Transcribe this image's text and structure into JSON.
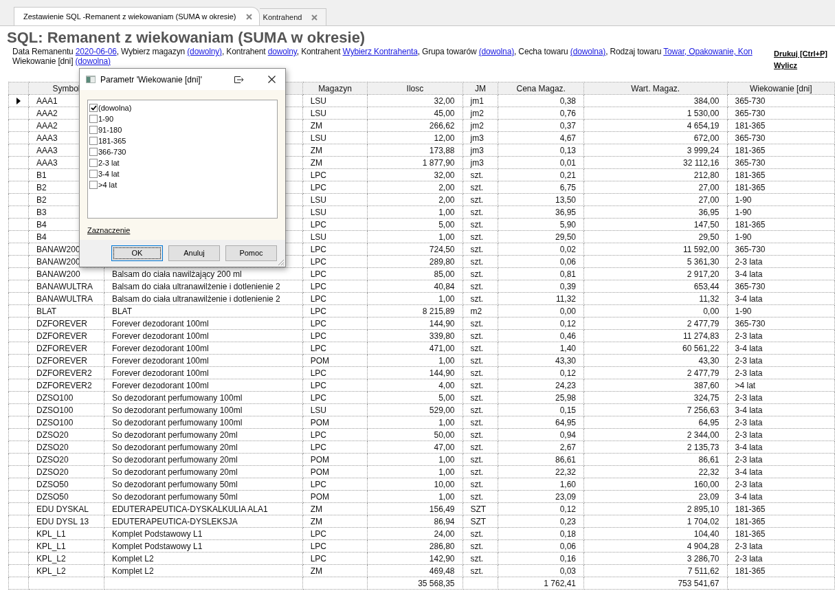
{
  "tabs": [
    {
      "label": "Zestawienie SQL -Remanent z wiekowaniam (SUMA w okresie)",
      "selected": true
    },
    {
      "label": "Kontrahend",
      "selected": false
    }
  ],
  "report": {
    "title": "SQL: Remanent z wiekowaniam (SUMA w okresie)",
    "parameter_lines": [
      [
        {
          "kind": "text",
          "text": "Data Remanentu "
        },
        {
          "kind": "link",
          "text": "2020-06-06"
        },
        {
          "kind": "text",
          "text": ", Wybierz magazyn "
        },
        {
          "kind": "link",
          "text": "(dowolny)"
        },
        {
          "kind": "text",
          "text": ", Kontrahent "
        },
        {
          "kind": "link",
          "text": "dowolny"
        },
        {
          "kind": "text",
          "text": ", Kontrahent "
        },
        {
          "kind": "link",
          "text": "Wybierz Kontrahenta"
        },
        {
          "kind": "text",
          "text": ", Grupa towarów "
        },
        {
          "kind": "link",
          "text": "(dowolna)"
        },
        {
          "kind": "text",
          "text": ", Cecha towaru "
        },
        {
          "kind": "link",
          "text": "(dowolna)"
        },
        {
          "kind": "text",
          "text": ", Rodzaj towaru "
        },
        {
          "kind": "link",
          "text": "Towar, Opakowanie, Kon"
        }
      ],
      [
        {
          "kind": "text",
          "text": "Wiekowanie [dni] "
        },
        {
          "kind": "link",
          "text": "(dowolna)"
        }
      ]
    ],
    "actions": [
      "Drukuj [Ctrl+P]",
      "Wylicz"
    ]
  },
  "table": {
    "columns": [
      "Symbol",
      null,
      "Magazyn",
      "Ilosc",
      "JM",
      "Cena Magaz.",
      "Wart. Magaz.",
      "Wiekowanie [dni]"
    ],
    "rows": [
      {
        "selected": true,
        "cells": [
          "AAA1",
          null,
          "LSU",
          "32,00",
          "jm1",
          "0,38",
          "384,00",
          "365-730"
        ]
      },
      {
        "selected": false,
        "cells": [
          "AAA2",
          null,
          "LSU",
          "45,00",
          "jm2",
          "0,76",
          "1 530,00",
          "365-730"
        ]
      },
      {
        "selected": false,
        "cells": [
          "AAA2",
          null,
          "ZM",
          "266,62",
          "jm2",
          "0,37",
          "4 654,19",
          "181-365"
        ]
      },
      {
        "selected": false,
        "cells": [
          "AAA3",
          null,
          "LSU",
          "12,00",
          "jm3",
          "4,67",
          "672,00",
          "365-730"
        ]
      },
      {
        "selected": false,
        "cells": [
          "AAA3",
          null,
          "ZM",
          "173,88",
          "jm3",
          "0,13",
          "3 999,24",
          "181-365"
        ]
      },
      {
        "selected": false,
        "cells": [
          "AAA3",
          null,
          "ZM",
          "1 877,90",
          "jm3",
          "0,01",
          "32 112,16",
          "365-730"
        ]
      },
      {
        "selected": false,
        "cells": [
          "B1",
          null,
          "LPC",
          "32,00",
          "szt.",
          "0,21",
          "212,80",
          "181-365"
        ]
      },
      {
        "selected": false,
        "cells": [
          "B2",
          null,
          "LPC",
          "2,00",
          "szt.",
          "6,75",
          "27,00",
          "181-365"
        ]
      },
      {
        "selected": false,
        "cells": [
          "B2",
          null,
          "LSU",
          "2,00",
          "szt.",
          "13,50",
          "27,00",
          "1-90"
        ]
      },
      {
        "selected": false,
        "cells": [
          "B3",
          null,
          "LSU",
          "1,00",
          "szt.",
          "36,95",
          "36,95",
          "1-90"
        ]
      },
      {
        "selected": false,
        "cells": [
          "B4",
          null,
          "LPC",
          "5,00",
          "szt.",
          "5,90",
          "147,50",
          "181-365"
        ]
      },
      {
        "selected": false,
        "cells": [
          "B4",
          null,
          "LSU",
          "1,00",
          "szt.",
          "29,50",
          "29,50",
          "1-90"
        ]
      },
      {
        "selected": false,
        "cells": [
          "BANAW200",
          null,
          "LPC",
          "724,50",
          "szt.",
          "0,02",
          "11 592,00",
          "365-730"
        ]
      },
      {
        "selected": false,
        "cells": [
          "BANAW200",
          null,
          "LPC",
          "289,80",
          "szt.",
          "0,06",
          "5 361,30",
          "2-3 lata"
        ]
      },
      {
        "selected": false,
        "cells": [
          "BANAW200",
          "Balsam do ciała nawilżający 200 ml",
          "LPC",
          "85,00",
          "szt.",
          "0,81",
          "2 917,20",
          "3-4 lata"
        ]
      },
      {
        "selected": false,
        "cells": [
          "BANAWULTRA",
          "Balsam do ciała ultranawilżenie i dotlenienie 2",
          "LPC",
          "40,84",
          "szt.",
          "0,39",
          "653,44",
          "365-730"
        ]
      },
      {
        "selected": false,
        "cells": [
          "BANAWULTRA",
          "Balsam do ciała ultranawilżenie i dotlenienie 2",
          "LPC",
          "1,00",
          "szt.",
          "11,32",
          "11,32",
          "3-4 lata"
        ]
      },
      {
        "selected": false,
        "cells": [
          "BLAT",
          "BLAT",
          "LPC",
          "8 215,89",
          "m2",
          "0,00",
          "0,00",
          "1-90"
        ]
      },
      {
        "selected": false,
        "cells": [
          "DZFOREVER",
          "Forever dezodorant 100ml",
          "LPC",
          "144,90",
          "szt.",
          "0,12",
          "2 477,79",
          "365-730"
        ]
      },
      {
        "selected": false,
        "cells": [
          "DZFOREVER",
          "Forever dezodorant 100ml",
          "LPC",
          "339,80",
          "szt.",
          "0,46",
          "11 274,83",
          "2-3 lata"
        ]
      },
      {
        "selected": false,
        "cells": [
          "DZFOREVER",
          "Forever dezodorant 100ml",
          "LPC",
          "471,00",
          "szt.",
          "1,40",
          "60 561,22",
          "3-4 lata"
        ]
      },
      {
        "selected": false,
        "cells": [
          "DZFOREVER",
          "Forever dezodorant 100ml",
          "POM",
          "1,00",
          "szt.",
          "43,30",
          "43,30",
          "2-3 lata"
        ]
      },
      {
        "selected": false,
        "cells": [
          "DZFOREVER2",
          "Forever dezodorant 100ml",
          "LPC",
          "144,90",
          "szt.",
          "0,12",
          "2 477,79",
          "2-3 lata"
        ]
      },
      {
        "selected": false,
        "cells": [
          "DZFOREVER2",
          "Forever dezodorant 100ml",
          "LPC",
          "4,00",
          "szt.",
          "24,23",
          "387,60",
          ">4 lat"
        ]
      },
      {
        "selected": false,
        "cells": [
          "DZSO100",
          "So dezodorant perfumowany 100ml",
          "LPC",
          "5,00",
          "szt.",
          "25,98",
          "324,75",
          "2-3 lata"
        ]
      },
      {
        "selected": false,
        "cells": [
          "DZSO100",
          "So dezodorant perfumowany 100ml",
          "LSU",
          "529,00",
          "szt.",
          "0,15",
          "7 256,63",
          "3-4 lata"
        ]
      },
      {
        "selected": false,
        "cells": [
          "DZSO100",
          "So dezodorant perfumowany 100ml",
          "POM",
          "1,00",
          "szt.",
          "64,95",
          "64,95",
          "2-3 lata"
        ]
      },
      {
        "selected": false,
        "cells": [
          "DZSO20",
          "So dezodorant perfumowany 20ml",
          "LPC",
          "50,00",
          "szt.",
          "0,94",
          "2 344,00",
          "2-3 lata"
        ]
      },
      {
        "selected": false,
        "cells": [
          "DZSO20",
          "So dezodorant perfumowany 20ml",
          "LPC",
          "47,00",
          "szt.",
          "2,67",
          "2 135,73",
          "3-4 lata"
        ]
      },
      {
        "selected": false,
        "cells": [
          "DZSO20",
          "So dezodorant perfumowany 20ml",
          "POM",
          "1,00",
          "szt.",
          "86,61",
          "86,61",
          "2-3 lata"
        ]
      },
      {
        "selected": false,
        "cells": [
          "DZSO20",
          "So dezodorant perfumowany 20ml",
          "POM",
          "1,00",
          "szt.",
          "22,32",
          "22,32",
          "3-4 lata"
        ]
      },
      {
        "selected": false,
        "cells": [
          "DZSO50",
          "So dezodorant perfumowany 50ml",
          "LPC",
          "10,00",
          "szt.",
          "1,60",
          "160,00",
          "2-3 lata"
        ]
      },
      {
        "selected": false,
        "cells": [
          "DZSO50",
          "So dezodorant perfumowany 50ml",
          "POM",
          "1,00",
          "szt.",
          "23,09",
          "23,09",
          "3-4 lata"
        ]
      },
      {
        "selected": false,
        "cells": [
          "EDU DYSKAL",
          "EDUTERAPEUTICA-DYSKALKULIA ALA1",
          "ZM",
          "156,49",
          "SZT",
          "0,12",
          "2 895,10",
          "181-365"
        ]
      },
      {
        "selected": false,
        "cells": [
          "EDU DYSL 13",
          "EDUTERAPEUTICA-DYSLEKSJA",
          "ZM",
          "86,94",
          "SZT",
          "0,23",
          "1 704,02",
          "181-365"
        ]
      },
      {
        "selected": false,
        "cells": [
          "KPL_L1",
          "Komplet Podstawowy L1",
          "LPC",
          "24,00",
          "szt.",
          "0,18",
          "104,40",
          "181-365"
        ]
      },
      {
        "selected": false,
        "cells": [
          "KPL_L1",
          "Komplet Podstawowy L1",
          "LPC",
          "286,80",
          "szt.",
          "0,06",
          "4 904,28",
          "2-3 lata"
        ]
      },
      {
        "selected": false,
        "cells": [
          "KPL_L2",
          "Komplet L2",
          "LPC",
          "142,90",
          "szt.",
          "0,16",
          "3 286,70",
          "2-3 lata"
        ]
      },
      {
        "selected": false,
        "cells": [
          "KPL_L2",
          "Komplet L2",
          "ZM",
          "469,48",
          "szt.",
          "0,03",
          "7 511,62",
          "181-365"
        ]
      }
    ],
    "totals": {
      "quantity": "35 568,35",
      "price": "1 762,41",
      "value": "753 541,67"
    }
  },
  "dialog": {
    "title": "Parametr 'Wiekowanie [dni]'",
    "options": [
      {
        "label": "(dowolna)",
        "checked": true
      },
      {
        "label": "1-90",
        "checked": false
      },
      {
        "label": "91-180",
        "checked": false
      },
      {
        "label": "181-365",
        "checked": false
      },
      {
        "label": "366-730",
        "checked": false
      },
      {
        "label": "2-3 lat",
        "checked": false
      },
      {
        "label": "3-4 lat",
        "checked": false
      },
      {
        "label": ">4 lat",
        "checked": false
      }
    ],
    "link": "Zaznaczenie",
    "buttons": [
      {
        "label": "OK",
        "focused": true
      },
      {
        "label": "Anuluj",
        "focused": false
      },
      {
        "label": "Pomoc",
        "focused": false
      }
    ]
  }
}
